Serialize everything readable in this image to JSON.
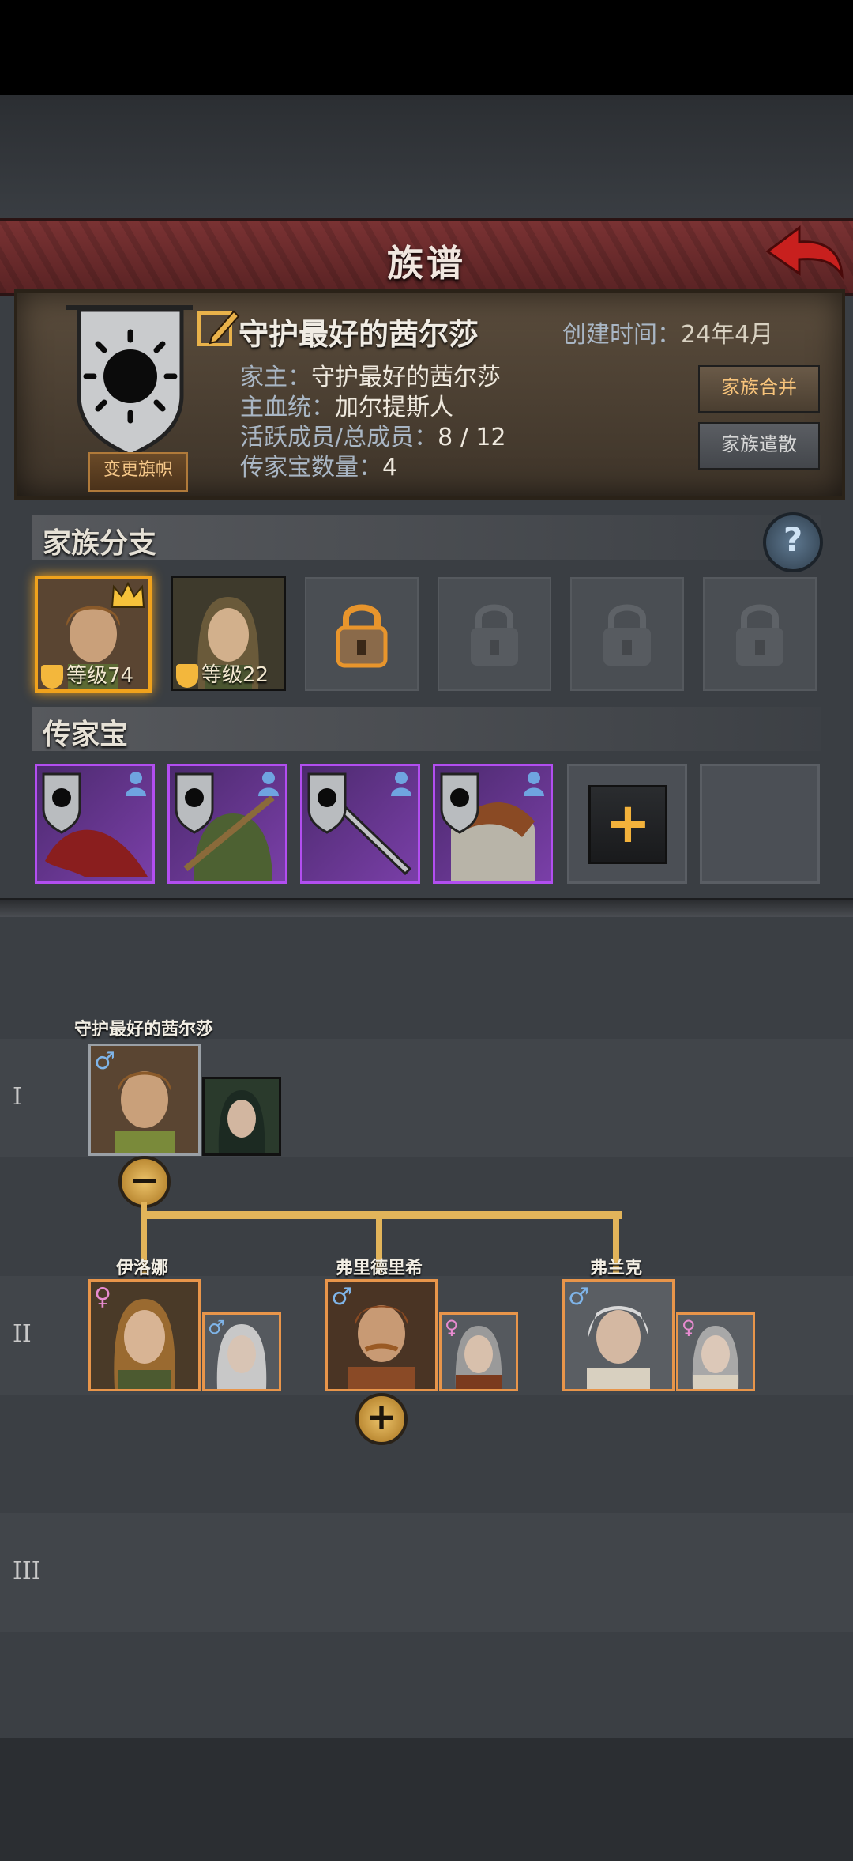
{
  "header": {
    "title": "族谱"
  },
  "family": {
    "name": "守护最好的茜尔莎",
    "created_label": "创建时间：",
    "created_value": "24年4月",
    "head_label": "家主：",
    "head_value": "守护最好的茜尔莎",
    "bloodline_label": "主血统：",
    "bloodline_value": "加尔提斯人",
    "members_label": "活跃成员/总成员：",
    "members_value": "8 / 12",
    "heirlooms_label": "传家宝数量：",
    "heirlooms_value": "4",
    "change_banner": "变更旗帜",
    "merge": "家族合并",
    "dissolve": "家族遣散"
  },
  "branches": {
    "title": "家族分支",
    "help": "?",
    "slots": [
      {
        "level": "等级74",
        "state": "active-leader"
      },
      {
        "level": "等级22",
        "state": "member"
      },
      {
        "state": "unlockable"
      },
      {
        "state": "locked"
      },
      {
        "state": "locked"
      },
      {
        "state": "locked"
      }
    ]
  },
  "heirlooms": {
    "title": "传家宝",
    "items": [
      {
        "icon": "dragon-wing-icon"
      },
      {
        "icon": "cloak-icon"
      },
      {
        "icon": "sword-icon"
      },
      {
        "icon": "chainmail-icon"
      }
    ],
    "add": "+"
  },
  "tree": {
    "generations": [
      "I",
      "II",
      "III"
    ],
    "gen1": {
      "name": "守护最好的茜尔莎",
      "gender": "♂",
      "toggle": "−"
    },
    "gen2": [
      {
        "name": "伊洛娜",
        "gender": "♀",
        "spouse_gender": "♂"
      },
      {
        "name": "弗里德里希",
        "gender": "♂",
        "spouse_gender": "♀",
        "toggle": "+"
      },
      {
        "name": "弗兰克",
        "gender": "♂",
        "spouse_gender": "♀"
      }
    ]
  },
  "colors": {
    "accent": "#f0a21c",
    "banner": "#7a3233",
    "heirloom_border": "#b24ef0"
  }
}
